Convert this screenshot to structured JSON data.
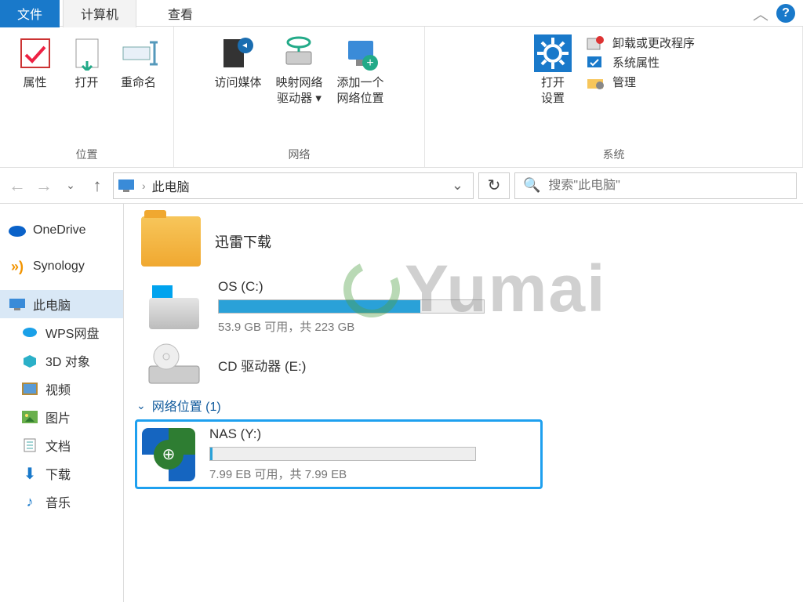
{
  "tabs": {
    "file": "文件",
    "computer": "计算机",
    "view": "查看"
  },
  "ribbon": {
    "group_location": "位置",
    "group_network": "网络",
    "group_system": "系统",
    "properties": "属性",
    "open": "打开",
    "rename": "重命名",
    "access_media": "访问媒体",
    "map_drive": "映射网络\n驱动器",
    "map_drive_arrow": "▾",
    "add_netloc": "添加一个\n网络位置",
    "open_settings": "打开\n设置",
    "uninstall": "卸载或更改程序",
    "sys_props": "系统属性",
    "manage": "管理"
  },
  "nav": {
    "crumb_sep": "›",
    "crumb": "此电脑",
    "search_placeholder": "搜索\"此电脑\""
  },
  "sidebar": {
    "onedrive": "OneDrive",
    "synology": "Synology",
    "thispc": "此电脑",
    "wps": "WPS网盘",
    "objects3d": "3D 对象",
    "videos": "视频",
    "pictures": "图片",
    "documents": "文档",
    "downloads": "下载",
    "music": "音乐"
  },
  "content": {
    "xunlei": "迅雷下载",
    "drive_c_name": "OS (C:)",
    "drive_c_sub": "53.9 GB 可用，共 223 GB",
    "cd_name": "CD 驱动器 (E:)",
    "netloc_header": "网络位置 (1)",
    "nas_name": "NAS (Y:)",
    "nas_sub": "7.99 EB 可用，共 7.99 EB"
  },
  "watermark": "Yumai"
}
